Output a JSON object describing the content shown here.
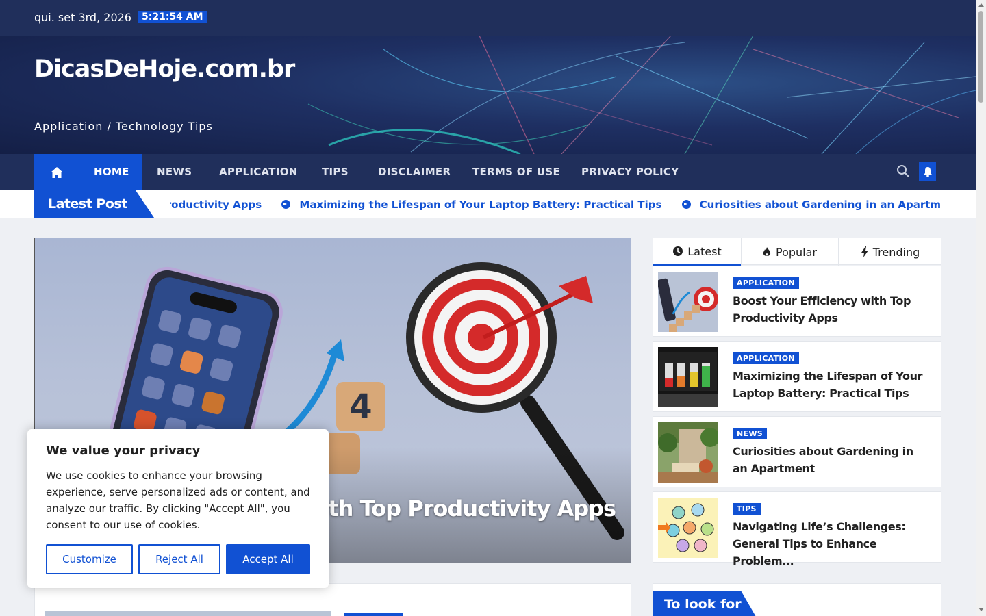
{
  "topbar": {
    "date": "qui. set 3rd, 2026",
    "time": "5:21:54 AM"
  },
  "site": {
    "title": "DicasDeHoje.com.br",
    "tagline": "Application / Technology Tips"
  },
  "nav": {
    "home_icon": "home-icon",
    "items": [
      "HOME",
      "NEWS",
      "APPLICATION",
      "TIPS",
      "DISCLAIMER",
      "TERMS OF USE",
      "PRIVACY POLICY"
    ],
    "search_icon": "search-icon",
    "bell_icon": "bell-icon"
  },
  "ticker": {
    "label": "Latest Post",
    "items": [
      "Boost Your Efficiency with Top Productivity Apps",
      "Maximizing the Lifespan of Your Laptop Battery: Practical Tips",
      "Curiosities about Gardening in an Apartment"
    ]
  },
  "hero": {
    "title": "Boost Your Efficiency with Top Productivity Apps"
  },
  "sidebar": {
    "tabs": [
      {
        "label": "Latest",
        "icon": "clock-icon"
      },
      {
        "label": "Popular",
        "icon": "flame-icon"
      },
      {
        "label": "Trending",
        "icon": "bolt-icon"
      }
    ],
    "posts": [
      {
        "category": "APPLICATION",
        "title": "Boost Your Efficiency with Top Productivity Apps"
      },
      {
        "category": "APPLICATION",
        "title": "Maximizing the Lifespan of Your Laptop Battery: Practical Tips"
      },
      {
        "category": "NEWS",
        "title": "Curiosities about Gardening in an Apartment"
      },
      {
        "category": "TIPS",
        "title": "Navigating Life’s Challenges: General Tips to Enhance Problem..."
      }
    ],
    "look_for": "To look for"
  },
  "cookie": {
    "heading": "We value your privacy",
    "body": "We use cookies to enhance your browsing experience, serve personalized ads or content, and analyze our traffic. By clicking \"Accept All\", you consent to our use of cookies.",
    "customize": "Customize",
    "reject": "Reject All",
    "accept": "Accept All"
  },
  "colors": {
    "navy": "#202f5b",
    "accent": "#1151d3"
  }
}
